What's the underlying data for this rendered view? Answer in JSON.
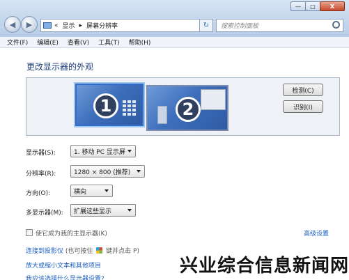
{
  "window": {
    "minimize": "—",
    "maximize": "□",
    "close": "X"
  },
  "address": {
    "prefix": "«",
    "crumb1": "显示",
    "separator": "▸",
    "crumb2": "屏幕分辨率"
  },
  "search": {
    "placeholder": "搜索控制面板"
  },
  "menu": [
    "文件(F)",
    "编辑(E)",
    "查看(V)",
    "工具(T)",
    "帮助(H)"
  ],
  "main": {
    "heading": "更改显示器的外观",
    "monitors": [
      {
        "number": "1"
      },
      {
        "number": "2"
      }
    ],
    "detect_button": "检测(C)",
    "identify_button": "识别(I)"
  },
  "settings": {
    "display": {
      "label": "显示器(S):",
      "value": "1. 移动 PC 显示屏"
    },
    "resolution": {
      "label": "分辨率(R):",
      "value": "1280 × 800 (推荐)"
    },
    "orientation": {
      "label": "方向(O):",
      "value": "横向"
    },
    "multi": {
      "label": "多显示器(M):",
      "value": "扩展这些显示"
    }
  },
  "primary_checkbox": "使它成为我的主显示器(K)",
  "advanced_link": "高级设置",
  "links": {
    "projector_a": "连接到投影仪",
    "projector_b": "(也可按住",
    "projector_c": "键并点击 P)",
    "text_size": "放大或缩小文本和其他项目",
    "which": "我应该选择什么显示器设置?"
  },
  "watermark": "兴业综合信息新闻网",
  "colors": {
    "link": "#1a5ec1",
    "heading": "#1d3d78",
    "selected_border": "#2f6bc8"
  }
}
